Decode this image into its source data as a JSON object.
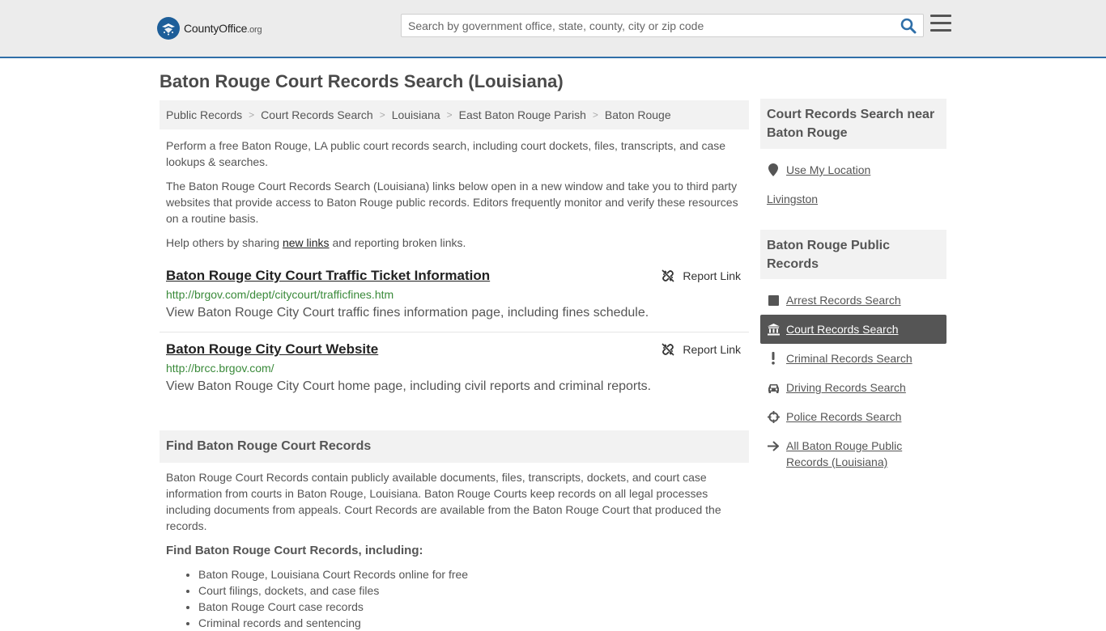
{
  "header": {
    "logo_text": "CountyOffice",
    "logo_tld": ".org",
    "search_placeholder": "Search by government office, state, county, city or zip code"
  },
  "page": {
    "title": "Baton Rouge Court Records Search (Louisiana)"
  },
  "breadcrumb": [
    "Public Records",
    "Court Records Search",
    "Louisiana",
    "East Baton Rouge Parish",
    "Baton Rouge"
  ],
  "intro": {
    "p1": "Perform a free Baton Rouge, LA public court records search, including court dockets, files, transcripts, and case lookups & searches.",
    "p2": "The Baton Rouge Court Records Search (Louisiana) links below open in a new window and take you to third party websites that provide access to Baton Rouge public records. Editors frequently monitor and verify these resources on a routine basis.",
    "p3_before": "Help others by sharing ",
    "p3_link": "new links",
    "p3_after": " and reporting broken links."
  },
  "links": [
    {
      "title": "Baton Rouge City Court Traffic Ticket Information",
      "url": "http://brgov.com/dept/citycourt/trafficfines.htm",
      "desc": "View Baton Rouge City Court traffic fines information page, including fines schedule.",
      "report": "Report Link"
    },
    {
      "title": "Baton Rouge City Court Website",
      "url": "http://brcc.brgov.com/",
      "desc": "View Baton Rouge City Court home page, including civil reports and criminal reports.",
      "report": "Report Link"
    }
  ],
  "find_section": {
    "heading": "Find Baton Rouge Court Records",
    "body": "Baton Rouge Court Records contain publicly available documents, files, transcripts, dockets, and court case information from courts in Baton Rouge, Louisiana. Baton Rouge Courts keep records on all legal processes including documents from appeals. Court Records are available from the Baton Rouge Court that produced the records.",
    "subheading": "Find Baton Rouge Court Records, including:",
    "bullets": [
      "Baton Rouge, Louisiana Court Records online for free",
      "Court filings, dockets, and case files",
      "Baton Rouge Court case records",
      "Criminal records and sentencing"
    ]
  },
  "sidebar": {
    "near_title": "Court Records Search near Baton Rouge",
    "use_location": "Use My Location",
    "nearby": "Livingston",
    "public_title": "Baton Rouge Public Records",
    "items": [
      {
        "label": "Arrest Records Search",
        "icon": "square-icon"
      },
      {
        "label": "Court Records Search",
        "icon": "courthouse-icon"
      },
      {
        "label": "Criminal Records Search",
        "icon": "exclamation-icon"
      },
      {
        "label": "Driving Records Search",
        "icon": "car-icon"
      },
      {
        "label": "Police Records Search",
        "icon": "crosshair-icon"
      }
    ],
    "all_records": "All Baton Rouge Public Records (Louisiana)"
  },
  "colors": {
    "accent_blue": "#2f6fa8",
    "url_green": "#3a8a3a",
    "active_bg": "#555555"
  }
}
